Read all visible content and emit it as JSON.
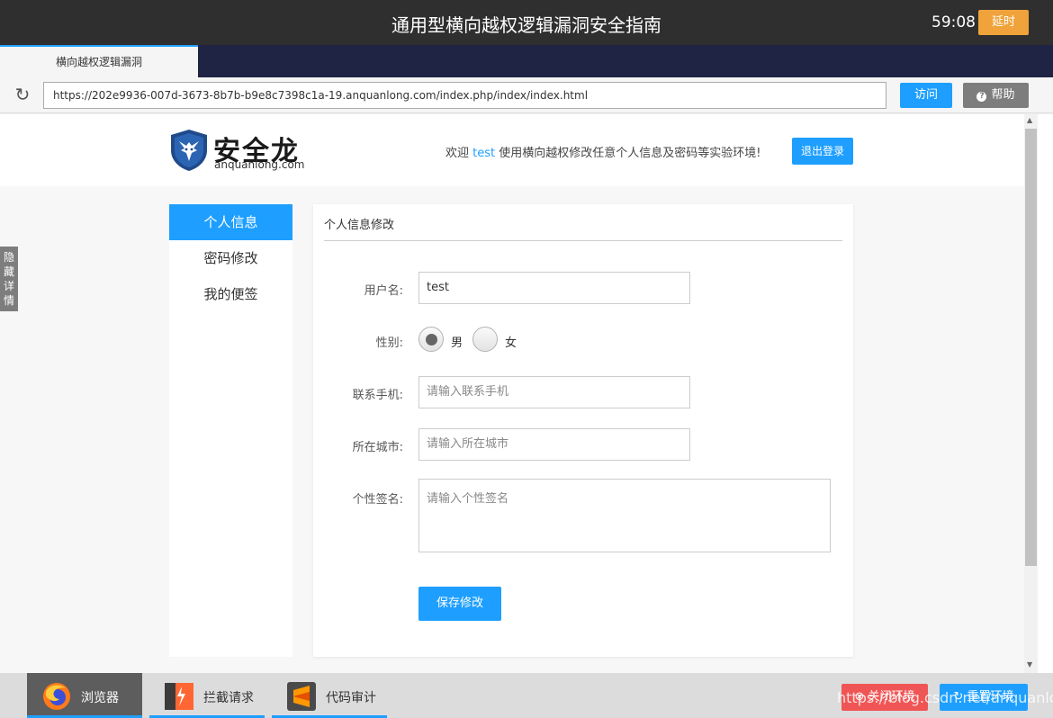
{
  "topbar": {
    "title": "通用型横向越权逻辑漏洞安全指南",
    "timer": "59:08",
    "delay_label": "延时"
  },
  "tabbar": {
    "tab_label": "横向越权逻辑漏洞"
  },
  "addressbar": {
    "url": "https://202e9936-007d-3673-8b7b-b9e8c7398c1a-19.anquanlong.com/index.php/index/index.html",
    "visit_label": "访问",
    "help_label": "帮助"
  },
  "site": {
    "logo_text": "安全龙",
    "logo_sub": "anquanlong.com",
    "welcome_prefix": "欢迎 ",
    "username": "test",
    "welcome_suffix": " 使用横向越权修改任意个人信息及密码等实验环境!",
    "logout_label": "退出登录"
  },
  "sidenav": {
    "items": [
      {
        "label": "个人信息"
      },
      {
        "label": "密码修改"
      },
      {
        "label": "我的便签"
      }
    ]
  },
  "form": {
    "title": "个人信息修改",
    "username_label": "用户名:",
    "username_value": "test",
    "gender_label": "性别:",
    "gender_male": "男",
    "gender_female": "女",
    "gender_selected": "男",
    "phone_label": "联系手机:",
    "phone_placeholder": "请输入联系手机",
    "city_label": "所在城市:",
    "city_placeholder": "请输入所在城市",
    "signature_label": "个性签名:",
    "signature_placeholder": "请输入个性签名",
    "save_label": "保存修改"
  },
  "side_toggle": {
    "label": "隐藏详情"
  },
  "taskbar": {
    "browser_label": "浏览器",
    "intercept_label": "拦截请求",
    "audit_label": "代码审计",
    "close_env_label": "关闭环境",
    "reset_env_label": "重置环境",
    "watermark": "https://blog.csdn.net/anquanlong"
  },
  "colors": {
    "accent": "#1e9fff",
    "topbar_bg": "#2f2f2f",
    "delay_orange": "#f0a33a",
    "close_red": "#f05555"
  }
}
